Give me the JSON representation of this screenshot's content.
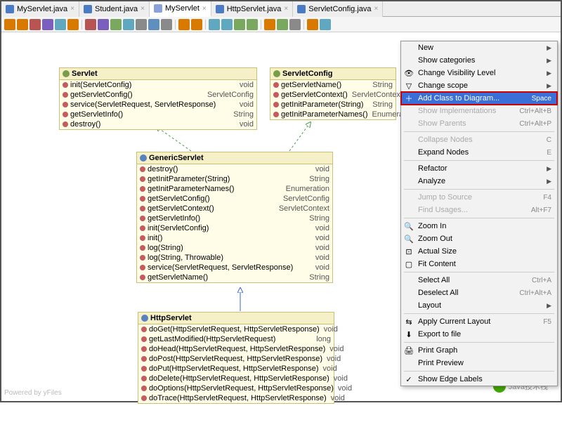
{
  "tabs": [
    {
      "label": "MyServlet.java",
      "icon": "java",
      "active": false
    },
    {
      "label": "Student.java",
      "icon": "java",
      "active": false
    },
    {
      "label": "MyServlet",
      "icon": "diag",
      "active": true
    },
    {
      "label": "HttpServlet.java",
      "icon": "java",
      "active": false
    },
    {
      "label": "ServletConfig.java",
      "icon": "java",
      "active": false
    }
  ],
  "classes": {
    "servlet": {
      "name": "Servlet",
      "type": "interface",
      "methods": [
        {
          "sig": "init(ServletConfig)",
          "ret": "void"
        },
        {
          "sig": "getServletConfig()",
          "ret": "ServletConfig"
        },
        {
          "sig": "service(ServletRequest, ServletResponse)",
          "ret": "void"
        },
        {
          "sig": "getServletInfo()",
          "ret": "String"
        },
        {
          "sig": "destroy()",
          "ret": "void"
        }
      ]
    },
    "servletconfig": {
      "name": "ServletConfig",
      "type": "interface",
      "methods": [
        {
          "sig": "getServletName()",
          "ret": "String"
        },
        {
          "sig": "getServletContext()",
          "ret": "ServletContext"
        },
        {
          "sig": "getInitParameter(String)",
          "ret": "String"
        },
        {
          "sig": "getInitParameterNames()",
          "ret": "Enumeration"
        }
      ]
    },
    "generic": {
      "name": "GenericServlet",
      "type": "class",
      "methods": [
        {
          "sig": "destroy()",
          "ret": "void"
        },
        {
          "sig": "getInitParameter(String)",
          "ret": "String"
        },
        {
          "sig": "getInitParameterNames()",
          "ret": "Enumeration"
        },
        {
          "sig": "getServletConfig()",
          "ret": "ServletConfig"
        },
        {
          "sig": "getServletContext()",
          "ret": "ServletContext"
        },
        {
          "sig": "getServletInfo()",
          "ret": "String"
        },
        {
          "sig": "init(ServletConfig)",
          "ret": "void"
        },
        {
          "sig": "init()",
          "ret": "void"
        },
        {
          "sig": "log(String)",
          "ret": "void"
        },
        {
          "sig": "log(String, Throwable)",
          "ret": "void"
        },
        {
          "sig": "service(ServletRequest, ServletResponse)",
          "ret": "void"
        },
        {
          "sig": "getServletName()",
          "ret": "String"
        }
      ]
    },
    "http": {
      "name": "HttpServlet",
      "type": "class",
      "methods": [
        {
          "sig": "doGet(HttpServletRequest, HttpServletResponse)",
          "ret": "void"
        },
        {
          "sig": "getLastModified(HttpServletRequest)",
          "ret": "long"
        },
        {
          "sig": "doHead(HttpServletRequest, HttpServletResponse)",
          "ret": "void"
        },
        {
          "sig": "doPost(HttpServletRequest, HttpServletResponse)",
          "ret": "void"
        },
        {
          "sig": "doPut(HttpServletRequest, HttpServletResponse)",
          "ret": "void"
        },
        {
          "sig": "doDelete(HttpServletRequest, HttpServletResponse)",
          "ret": "void"
        },
        {
          "sig": "doOptions(HttpServletRequest, HttpServletResponse)",
          "ret": "void"
        },
        {
          "sig": "doTrace(HttpServletRequest, HttpServletResponse)",
          "ret": "void"
        }
      ]
    }
  },
  "ctx": [
    {
      "label": "New",
      "sub": true
    },
    {
      "label": "Show categories",
      "sub": true
    },
    {
      "label": "Change Visibility Level",
      "sub": true,
      "icon": "vis"
    },
    {
      "label": "Change scope",
      "sub": true,
      "icon": "scope"
    },
    {
      "label": "Add Class to Diagram...",
      "shortcut": "Space",
      "hl": true,
      "icon": "add"
    },
    {
      "label": "Show Implementations",
      "shortcut": "Ctrl+Alt+B",
      "dis": true
    },
    {
      "label": "Show Parents",
      "shortcut": "Ctrl+Alt+P",
      "dis": true
    },
    {
      "sep": true
    },
    {
      "label": "Collapse Nodes",
      "shortcut": "C",
      "dis": true
    },
    {
      "label": "Expand Nodes",
      "shortcut": "E"
    },
    {
      "sep": true
    },
    {
      "label": "Refactor",
      "sub": true
    },
    {
      "label": "Analyze",
      "sub": true
    },
    {
      "sep": true
    },
    {
      "label": "Jump to Source",
      "shortcut": "F4",
      "dis": true
    },
    {
      "label": "Find Usages...",
      "shortcut": "Alt+F7",
      "dis": true
    },
    {
      "sep": true
    },
    {
      "label": "Zoom In",
      "icon": "zi"
    },
    {
      "label": "Zoom Out",
      "icon": "zo"
    },
    {
      "label": "Actual Size",
      "icon": "as"
    },
    {
      "label": "Fit Content",
      "icon": "fc"
    },
    {
      "sep": true
    },
    {
      "label": "Select All",
      "shortcut": "Ctrl+A"
    },
    {
      "label": "Deselect All",
      "shortcut": "Ctrl+Alt+A"
    },
    {
      "label": "Layout",
      "sub": true
    },
    {
      "sep": true
    },
    {
      "label": "Apply Current Layout",
      "shortcut": "F5",
      "icon": "ly"
    },
    {
      "label": "Export to file",
      "icon": "ex"
    },
    {
      "sep": true
    },
    {
      "label": "Print Graph",
      "icon": "pr"
    },
    {
      "label": "Print Preview"
    },
    {
      "sep": true
    },
    {
      "label": "Show Edge Labels",
      "check": true
    }
  ],
  "toolbar_colors": [
    "#d97a00",
    "#d97a00",
    "#b85454",
    "#7a5fbf",
    "#5fa8bf",
    "#d97a00",
    "#b85454",
    "#7a5fbf",
    "#7aa85f",
    "#5fa8bf",
    "#8a8a8a",
    "#5f8fbf",
    "#8a8a8a",
    "#d97a00",
    "#d97a00",
    "#5fa8bf",
    "#5fa8bf",
    "#7aa85f",
    "#7aa85f",
    "#d97a00",
    "#7aa85f",
    "#8a8a8a",
    "#d97a00",
    "#5fa8bf"
  ],
  "watermark": "Java技术栈",
  "powered": "Powered by yFiles"
}
